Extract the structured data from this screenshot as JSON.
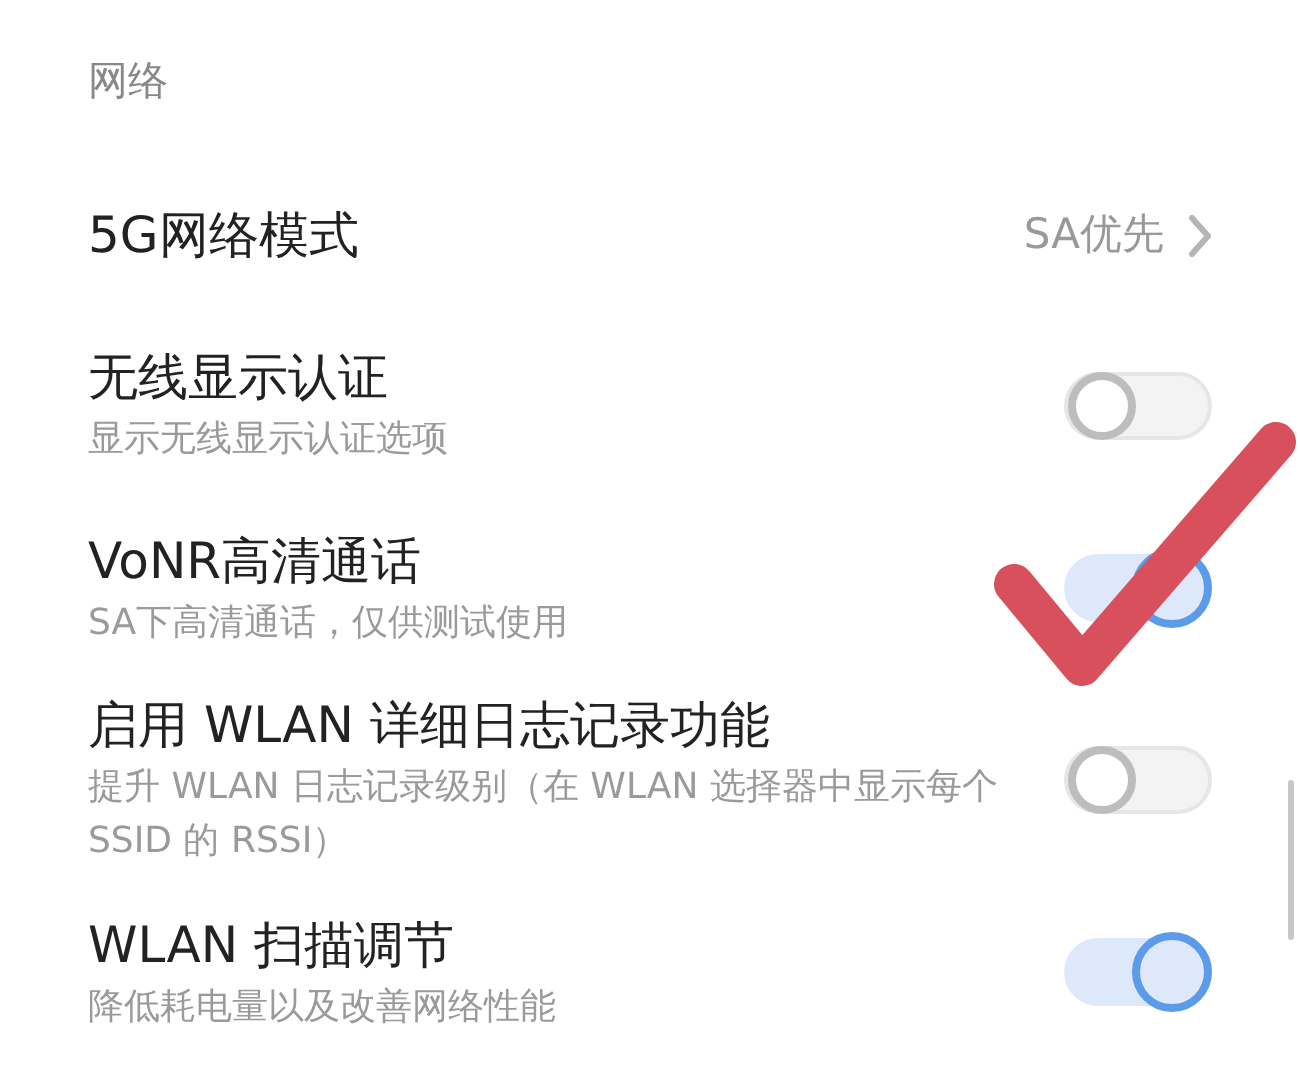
{
  "section_header": "网络",
  "settings": [
    {
      "kind": "link",
      "title": "5G网络模式",
      "value": "SA优先"
    },
    {
      "kind": "toggle",
      "title": "无线显示认证",
      "subtitle": "显示无线显示认证选项",
      "on": false
    },
    {
      "kind": "toggle",
      "title": "VoNR高清通话",
      "subtitle": "SA下高清通话，仅供测试使用",
      "on": true
    },
    {
      "kind": "toggle",
      "title": "启用 WLAN 详细日志记录功能",
      "subtitle": "提升 WLAN 日志记录级别（在 WLAN 选择器中显示每个 SSID 的 RSSI）",
      "on": false
    },
    {
      "kind": "toggle",
      "title": "WLAN 扫描调节",
      "subtitle": "降低耗电量以及改善网络性能",
      "on": true
    }
  ]
}
